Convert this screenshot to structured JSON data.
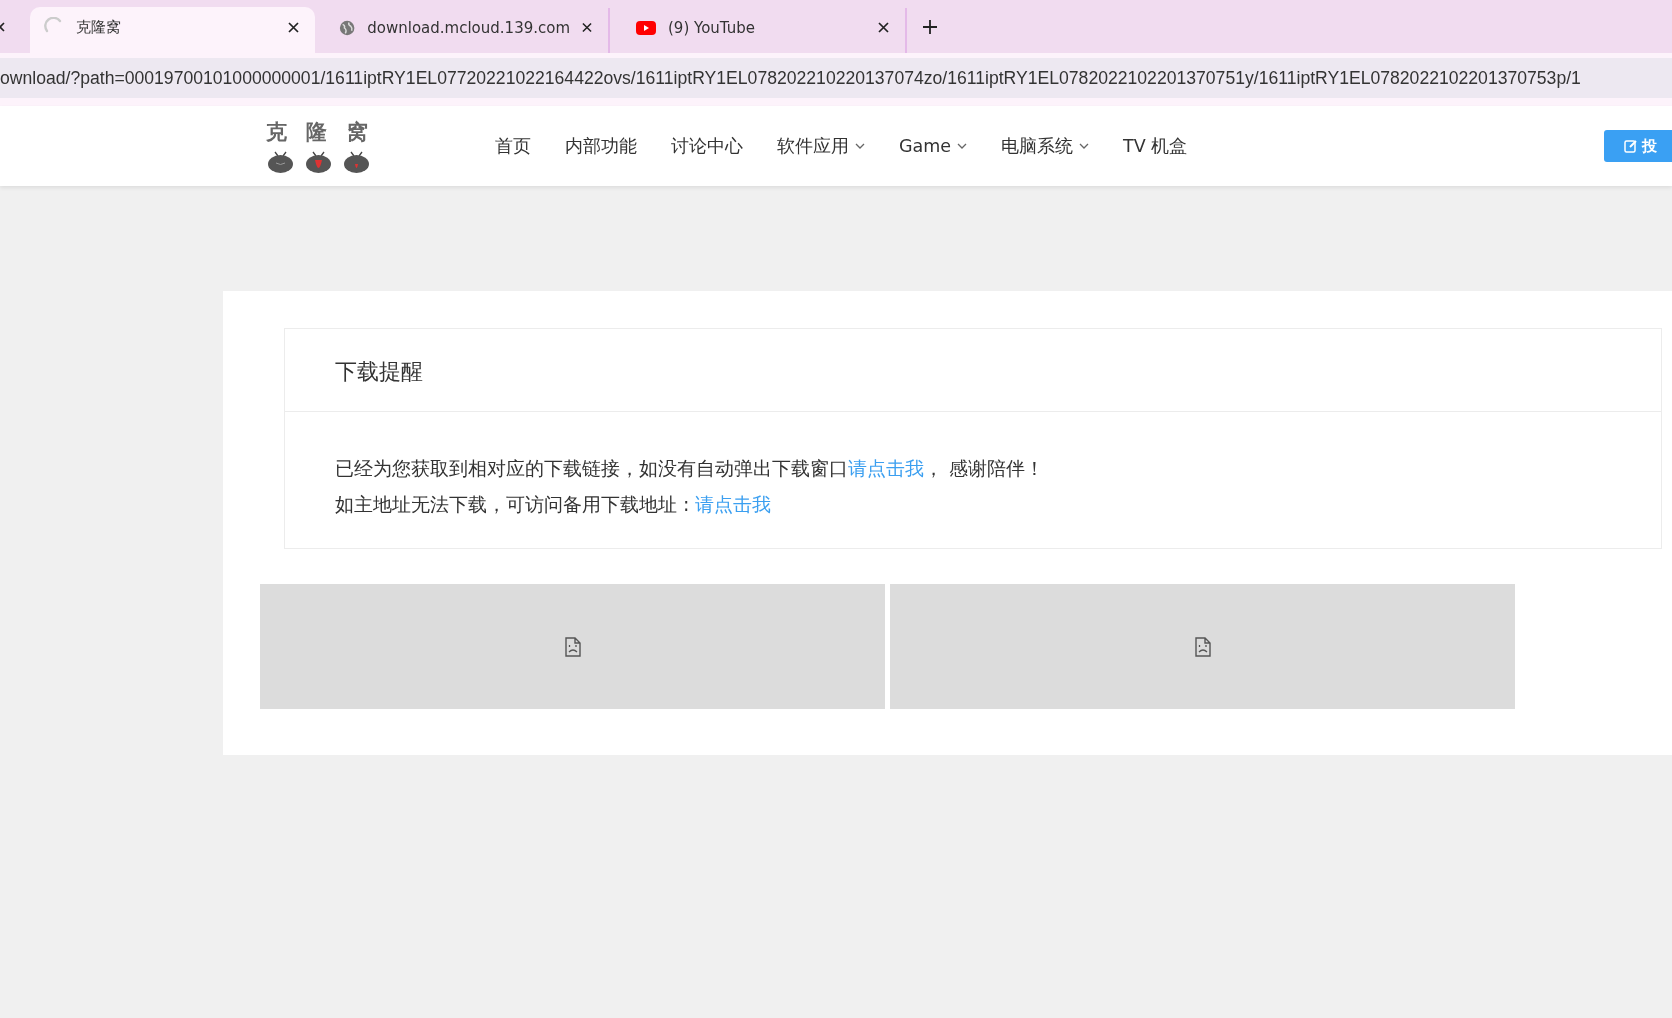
{
  "browser": {
    "tabs": [
      {
        "title": "克隆窝",
        "kind": "loading",
        "selected": true
      },
      {
        "title": "download.mcloud.139.com",
        "kind": "site",
        "selected": false
      },
      {
        "title": "(9) YouTube",
        "kind": "video",
        "selected": false
      }
    ],
    "url": "ownload/?path=00019700101000000001/1611iptRY1EL07720221022164422ovs/1611iptRY1EL078202210220137074zo/1611iptRY1EL0782022102201370751y/1611iptRY1EL0782022102201370753p/1"
  },
  "site": {
    "logo": "克 隆 窝",
    "nav": [
      {
        "label": "首页",
        "dropdown": false
      },
      {
        "label": "内部功能",
        "dropdown": false
      },
      {
        "label": "讨论中心",
        "dropdown": false
      },
      {
        "label": "软件应用",
        "dropdown": true
      },
      {
        "label": "Game",
        "dropdown": true
      },
      {
        "label": "电脑系统",
        "dropdown": true
      },
      {
        "label": "TV 机盒",
        "dropdown": false
      }
    ],
    "submit_button": "投"
  },
  "notice": {
    "title": "下载提醒",
    "lines": [
      {
        "before": "已经为您获取到相对应的下载链接，如没有自动弹出下载窗口",
        "link": "请点击我",
        "after": "，  感谢陪伴！"
      },
      {
        "before": "如主地址无法下载，可访问备用下载地址 : ",
        "link": "请点击我"
      }
    ]
  },
  "images": [
    {
      "kind": "broken"
    },
    {
      "kind": "broken"
    }
  ]
}
